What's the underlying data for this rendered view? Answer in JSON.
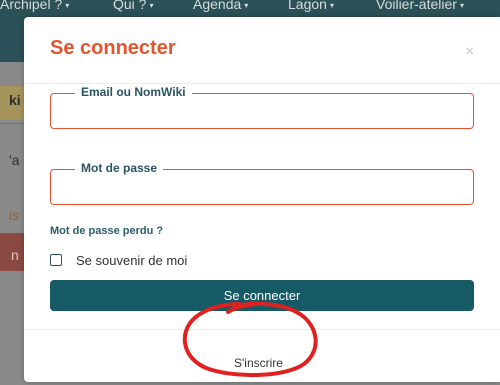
{
  "background": {
    "nav_items": [
      "Archipel ?",
      "Qui ?",
      "Agenda",
      "Lagon",
      "Voilier-atelier"
    ],
    "fragments": [
      "ki",
      "'a",
      "is",
      "n"
    ]
  },
  "modal": {
    "title": "Se connecter",
    "close_icon": "close-icon",
    "email_label": "Email ou NomWiki",
    "email_value": "",
    "password_label": "Mot de passe",
    "password_value": "",
    "forgot_password": "Mot de passe perdu ?",
    "remember_me": "Se souvenir de moi",
    "remember_checked": false,
    "submit": "Se connecter",
    "register": "S'inscrire"
  },
  "colors": {
    "accent": "#e3542f",
    "primary": "#165a66",
    "annotation": "#e0211f"
  }
}
